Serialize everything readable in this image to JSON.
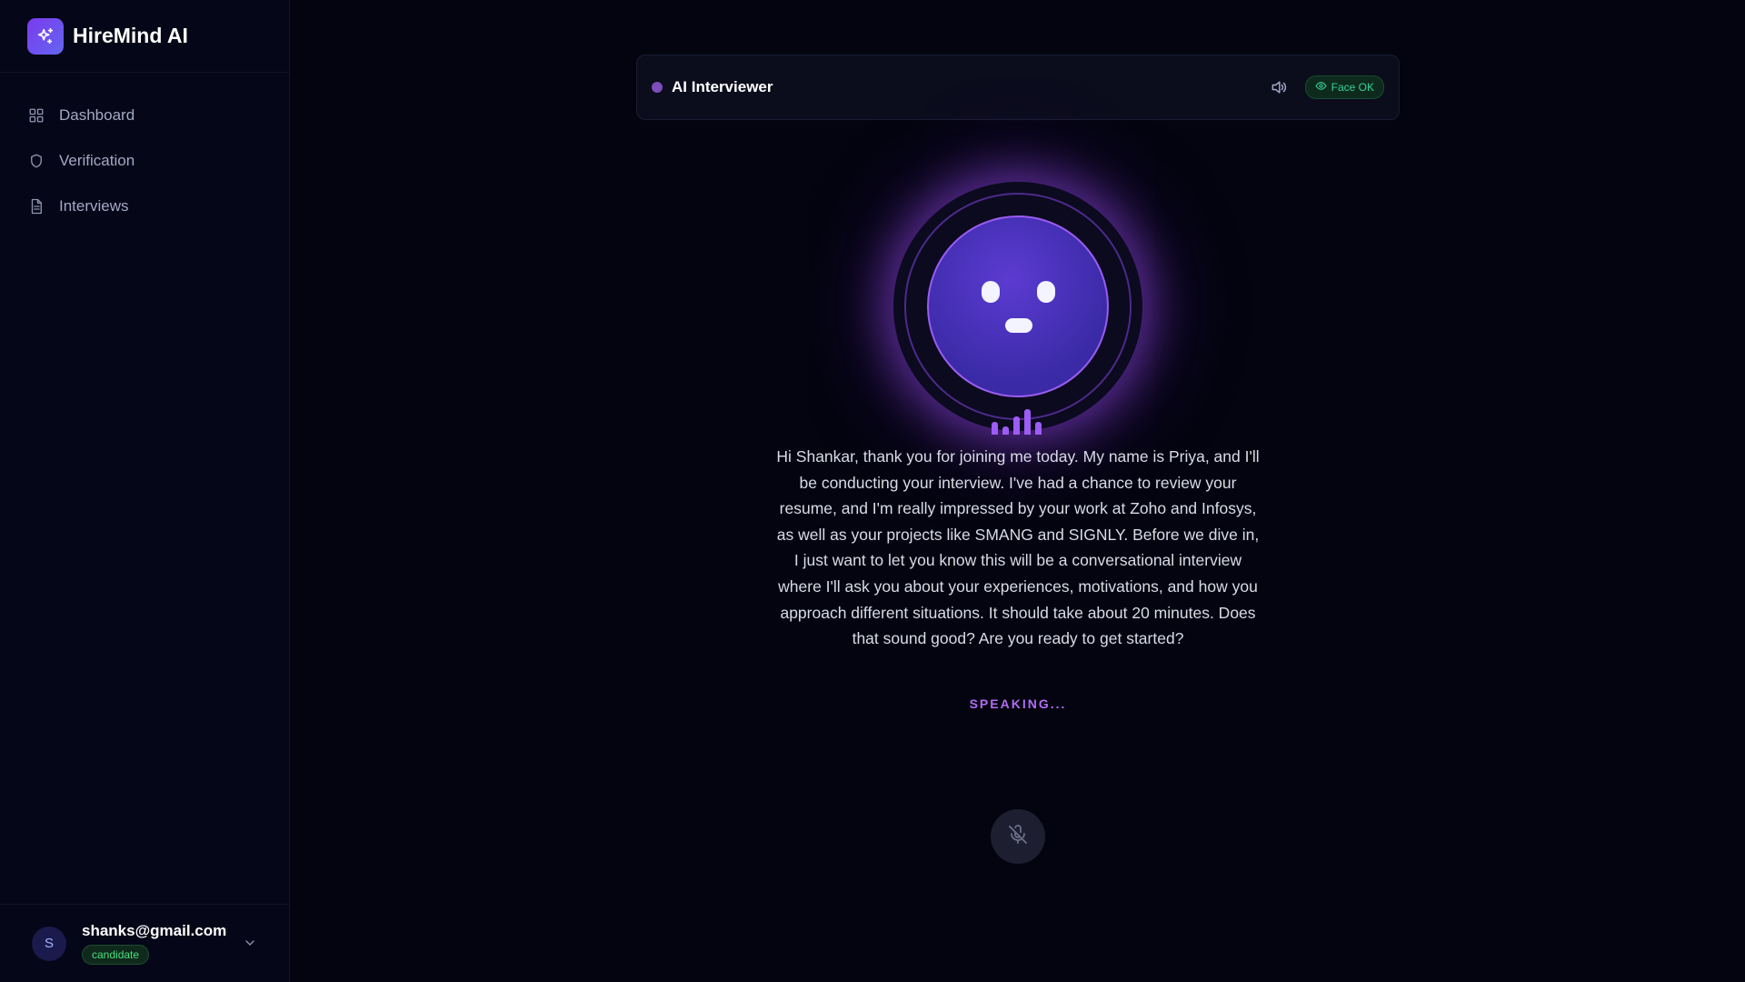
{
  "brand": {
    "name": "HireMind AI",
    "icon": "sparkles-icon",
    "accent": "#7c3aed"
  },
  "sidebar": {
    "items": [
      {
        "label": "Dashboard",
        "icon": "grid-icon"
      },
      {
        "label": "Verification",
        "icon": "shield-icon"
      },
      {
        "label": "Interviews",
        "icon": "document-icon"
      }
    ]
  },
  "user": {
    "initial": "S",
    "email": "shanks@gmail.com",
    "role": "candidate"
  },
  "interviewer": {
    "title": "AI Interviewer",
    "face_status": "Face OK",
    "transcript": "Hi Shankar, thank you for joining me today. My name is Priya, and I'll be conducting your interview. I've had a chance to review your resume, and I'm really impressed by your work at Zoho and Infosys, as well as your projects like SMANG and SIGNLY. Before we dive in, I just want to let you know this will be a conversational interview where I'll ask you about your experiences, motivations, and how you approach different situations. It should take about 20 minutes. Does that sound good? Are you ready to get started?",
    "status": "SPEAKING..."
  },
  "colors": {
    "background": "#03040f",
    "speaking": "#b26cf2",
    "success": "#34d399"
  }
}
